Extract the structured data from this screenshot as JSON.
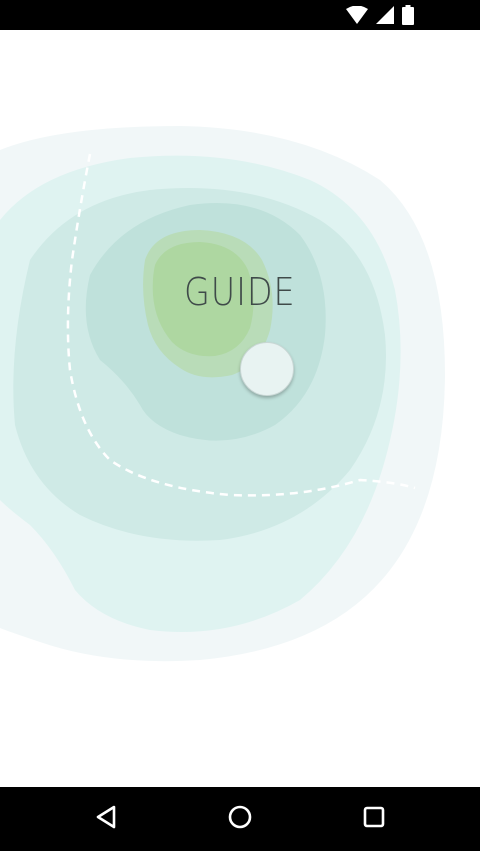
{
  "screen": {
    "title": "GUIDE"
  },
  "status_bar": {
    "icons": [
      "wifi-icon",
      "cellular-signal-icon",
      "battery-icon"
    ]
  },
  "map": {
    "marker": "location-marker"
  },
  "nav_bar": {
    "buttons": [
      "back-icon",
      "home-icon",
      "recents-icon"
    ]
  },
  "colors": {
    "background": "#ffffff",
    "outer_zone": "#f1f7f8",
    "mid_zone": "#dff3f1",
    "inner_zone": "#c8e6e1",
    "core_zone": "#b5dcc4",
    "center_zone": "#a9d7a0",
    "title_text": "#3f4a49",
    "route_line": "#ffffff",
    "system_bars": "#000000"
  }
}
